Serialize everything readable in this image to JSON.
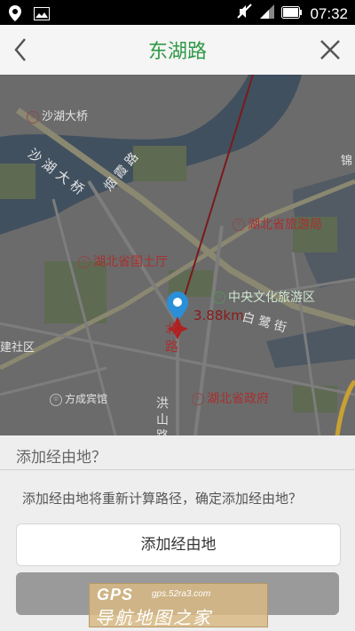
{
  "status_bar": {
    "time": "07:32",
    "icons": [
      "location-icon",
      "image-icon",
      "mute-icon",
      "signal-icon",
      "battery-icon"
    ]
  },
  "appbar": {
    "title": "东湖路",
    "back_icon": "chevron-left-icon",
    "close_icon": "close-icon"
  },
  "map": {
    "labels": {
      "shahu_bridge": "沙湖大桥",
      "shahu_bridge_road": "沙 湖 大 桥",
      "yanxia_road": "烟 霞 路",
      "hubei_tourism": "湖北省旅游局",
      "hubei_land": "湖北省国土厅",
      "central_culture": "中央文化旅游区",
      "bailu_street": "白 鹭 街",
      "north_road": "北 路",
      "community": "建社区",
      "fangcheng_hotel": "方成宾馆",
      "hubei_government": "湖北省政府",
      "hongshan_road": "洪 山 路",
      "edge_label": "锦"
    },
    "distance": "3.88km",
    "colors": {
      "water": "#41505f",
      "land": "#6b6b6b",
      "road": "#8b8871",
      "park": "#5e6a52",
      "route": "#7a1a1a"
    }
  },
  "dialog": {
    "title": "添加经由地？",
    "message": "添加经由地将重新计算路径，确定添加经由地？",
    "confirm_label": "添加经由地"
  },
  "watermark": {
    "logo": "GPS",
    "site": "gps.52ra3.com",
    "brand": "导航地图之家"
  }
}
